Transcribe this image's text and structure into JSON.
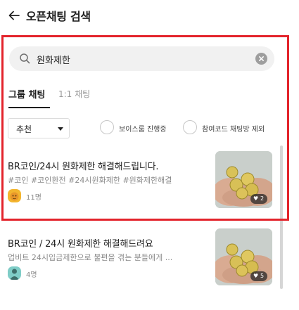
{
  "header": {
    "title": "오픈채팅 검색",
    "back_icon": "arrow-left-icon"
  },
  "search": {
    "query": "원화제한",
    "search_icon": "search-icon",
    "clear_icon": "clear-icon"
  },
  "tabs": [
    {
      "label": "그룹 채팅",
      "selected": true
    },
    {
      "label": "1:1 채팅",
      "selected": false
    }
  ],
  "filters": {
    "sort_label": "추천",
    "options": [
      {
        "label": "보이스룸 진행중",
        "checked": false
      },
      {
        "label": "참여코드 채팅방 제외",
        "checked": false
      }
    ]
  },
  "rooms": [
    {
      "title": "BR코인/24시 원화제한 해결해드립니다.",
      "description": "#코인 #코인환전 #24시원화제한 #원화제한해결",
      "members": "11명",
      "likes": "2"
    },
    {
      "title": "BR코인 / 24시 원화제한 해결해드려요",
      "description": "업비트 24시입금제한으로 불편을 겪는 분들에게 ...",
      "members": "4명",
      "likes": "5"
    }
  ],
  "colors": {
    "highlight": "#e3232b",
    "search_bg": "#f1f1f1",
    "accent_text": "#1e1e1e",
    "muted_text": "#8a8a8a"
  }
}
